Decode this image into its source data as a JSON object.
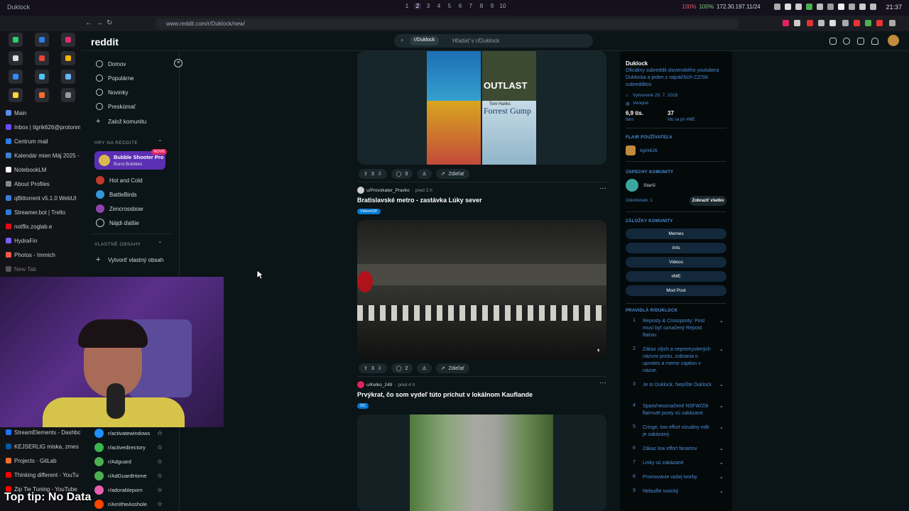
{
  "os_bar": {
    "title": "Duklock",
    "workspaces": [
      "1",
      "2",
      "3",
      "4",
      "5",
      "6",
      "7",
      "8",
      "9",
      "10"
    ],
    "active_workspace": "2",
    "cpu": "100%",
    "mem": "100%",
    "ip": "172.30.197.11/24",
    "clock": "21:37"
  },
  "browser": {
    "url": "www.reddit.com/r/Duklock/new/",
    "tabs": [
      {
        "label": "Main",
        "color": "#5a8dee"
      },
      {
        "label": "Inbox | tigrik626@protonm",
        "color": "#6d4aff"
      },
      {
        "label": "Centrum mail",
        "color": "#2b7de9"
      },
      {
        "label": "Kalendár mien Máj 2025 -",
        "color": "#3d7fd4"
      },
      {
        "label": "NotebookLM",
        "color": "#ffffff"
      },
      {
        "label": "About Profiles",
        "color": "#888888"
      },
      {
        "label": "qBittorrent v5.1.0 WebUI",
        "color": "#3a7bd5"
      },
      {
        "label": "Streamer.bot | Trello",
        "color": "#2d7ad8"
      },
      {
        "label": "notflix.zoglab.e",
        "color": "#e50914"
      },
      {
        "label": "HydraFin",
        "color": "#7b5cff"
      },
      {
        "label": "Photos - Immich",
        "color": "#f05a46"
      },
      {
        "label": "New Tab",
        "color": "#555555"
      }
    ],
    "lower_tabs": [
      {
        "label": "StreamElements - Dashbo",
        "color": "#1e73ff"
      },
      {
        "label": "KEJSERLIG miska, zmes fa",
        "color": "#0058a3"
      },
      {
        "label": "Projects · GitLab",
        "color": "#fc6d26"
      },
      {
        "label": "Thinking different - YouTu",
        "color": "#ff0000"
      },
      {
        "label": "Zip Tie Tuning - YouTube",
        "color": "#ff0000"
      }
    ]
  },
  "reddit": {
    "logo": "reddit",
    "search": {
      "chip": "r/Duklock",
      "placeholder": "Hľadať v r/Duklock"
    },
    "nav": {
      "home": "Domov",
      "popular": "Populárne",
      "news": "Novinky",
      "explore": "Preskúmať",
      "create": "Založ komunitu",
      "games_header": "HRY NA REDDITE",
      "promo_title": "Bubble Shooter Pro",
      "promo_sub": "Burst Bubbles",
      "promo_badge": "NOVÉ",
      "games": [
        "Hot and Cold",
        "BattleBirds",
        "Zencrossbow",
        "Nájdi ďalšie"
      ],
      "custom_header": "VLASTNÉ OBSAHY",
      "custom_create": "Vytvoriť vlastný obsah",
      "subs": [
        "r/activatewindows",
        "r/activedirectory",
        "r/Adguard",
        "r/AdGuardHome",
        "r/adorableporn",
        "r/AmItheAsshole"
      ]
    },
    "posts": [
      {
        "votes": "3",
        "comments": "0",
        "share": "Zdieľať",
        "grid": [
          "OUTLAST",
          "Tom Hanks",
          "Forrest Gump"
        ]
      },
      {
        "author": "u/Provokater_Pravko",
        "time": "pred 2 h",
        "title": "Bratislavské metro - zastávka Lúky sever",
        "flair": "Video/GIF",
        "votes": "3",
        "comments": "2",
        "share": "Zdieľať"
      },
      {
        "author": "u/Kelko_249",
        "time": "pred 4 h",
        "title": "Prvýkrat, čo som vydeľ túto príchut v lokálnom Kauflande",
        "flair": "OC",
        "votes": "",
        "comments": "",
        "share": ""
      }
    ],
    "sidebar": {
      "name": "Duklock",
      "desc": "Oficiálny subreddit slovenského youtubera Duklocka a jeden z najväčších CZ/SK subredditov.",
      "created": "Vytvorené 29. 7. 2018",
      "visibility": "Verejné",
      "members": "6,9 tis.",
      "members_label": "fans",
      "online": "37",
      "online_label": "Idú sa pri #ME",
      "flair_header": "FLAIR POUŽÍVATEĽA",
      "flair_user": "tigrik626",
      "achievements_header": "ÚSPECHY KOMUNITY",
      "achievement": "Starší",
      "unlocked": "Odomknuté: 1",
      "show_all": "Zobraziť všetko",
      "bookmarks_header": "ZÁLOŽKY KOMUNITY",
      "bookmarks": [
        "Memes",
        "Arts",
        "Videos",
        "#ME",
        "Mod Post"
      ],
      "rules_header": "PRAVIDLÁ R/DUKLOCK",
      "rules": [
        {
          "n": "1",
          "text": "Reposty & Crossposty: Post musí byť označený Repost flairou."
        },
        {
          "n": "2",
          "text": "Zákaz zlých a nepremyslených názvov postu, zobrania o upvotes a meme caption v názve."
        },
        {
          "n": "3",
          "text": "Je to Duklock. Nepíšte Duklock."
        },
        {
          "n": "4",
          "text": "Spam/neoznačené NSFW/Zlé flairnuté posty sú zakázané."
        },
        {
          "n": "5",
          "text": "Cringe, low effort vizuálny edit je zakázaný."
        },
        {
          "n": "6",
          "text": "Zákaz low effort fanartov"
        },
        {
          "n": "7",
          "text": "Linky sú zakázané"
        },
        {
          "n": "8",
          "text": "Promovanie vašej tvorby"
        },
        {
          "n": "9",
          "text": "Nebuďte toxický"
        }
      ]
    }
  },
  "overlay": {
    "caption": "Top tip: No Data"
  }
}
